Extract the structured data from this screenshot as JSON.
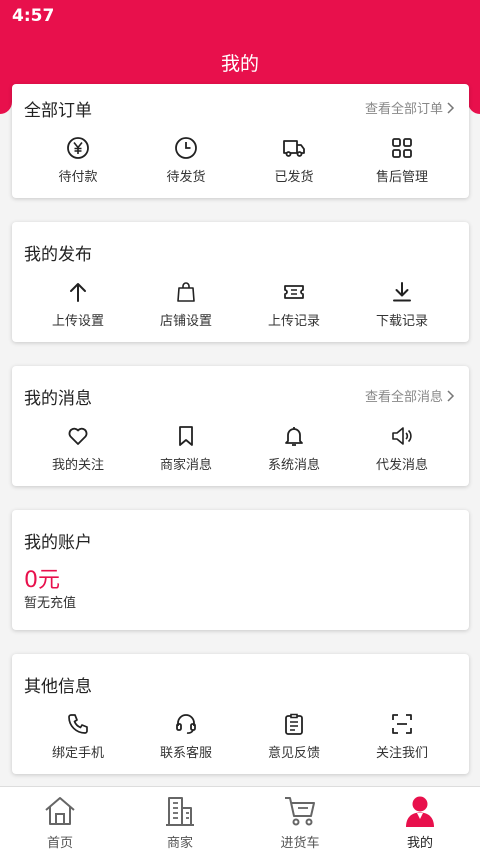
{
  "status_bar": {
    "time": "4:57"
  },
  "header": {
    "title": "我的"
  },
  "orders": {
    "title": "全部订单",
    "link": "查看全部订单",
    "items": [
      {
        "label": "待付款",
        "icon": "yen-icon"
      },
      {
        "label": "待发货",
        "icon": "clock-icon"
      },
      {
        "label": "已发货",
        "icon": "truck-icon"
      },
      {
        "label": "售后管理",
        "icon": "grid-icon"
      }
    ]
  },
  "publish": {
    "title": "我的发布",
    "items": [
      {
        "label": "上传设置",
        "icon": "upload-arrow-icon"
      },
      {
        "label": "店铺设置",
        "icon": "shopping-bag-icon"
      },
      {
        "label": "上传记录",
        "icon": "ticket-icon"
      },
      {
        "label": "下载记录",
        "icon": "download-icon"
      }
    ]
  },
  "messages": {
    "title": "我的消息",
    "link": "查看全部消息",
    "items": [
      {
        "label": "我的关注",
        "icon": "heart-icon"
      },
      {
        "label": "商家消息",
        "icon": "bookmark-icon"
      },
      {
        "label": "系统消息",
        "icon": "bell-icon"
      },
      {
        "label": "代发消息",
        "icon": "speaker-icon"
      }
    ]
  },
  "account": {
    "title": "我的账户",
    "balance": "0元",
    "note": "暂无充值"
  },
  "other": {
    "title": "其他信息",
    "items": [
      {
        "label": "绑定手机",
        "icon": "phone-icon"
      },
      {
        "label": "联系客服",
        "icon": "headset-icon"
      },
      {
        "label": "意见反馈",
        "icon": "clipboard-icon"
      },
      {
        "label": "关注我们",
        "icon": "scan-icon"
      }
    ]
  },
  "tabbar": {
    "items": [
      {
        "label": "首页",
        "icon": "home-icon"
      },
      {
        "label": "商家",
        "icon": "building-icon"
      },
      {
        "label": "进货车",
        "icon": "cart-icon"
      },
      {
        "label": "我的",
        "icon": "user-icon",
        "active": true
      }
    ]
  },
  "colors": {
    "brand": "#e8104c",
    "background": "#f4f4f4"
  }
}
